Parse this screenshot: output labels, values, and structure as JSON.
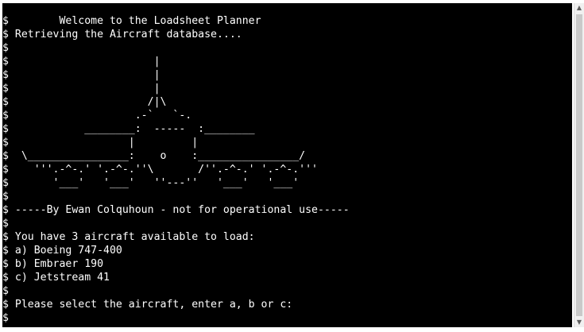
{
  "terminal": {
    "prompt_symbol": "$",
    "lines": [
      "        Welcome to the Loadsheet Planner",
      " Retrieving the Aircraft database....",
      "",
      "                       |",
      "                       |",
      "                       |",
      "                      /|\\",
      "                    .-`   `-.",
      "            ________:  -----  :________",
      "                   |         |",
      "  \\________________:    o    :________________/",
      "    '''.-^-.' '.-^-.''\\       /''.-^-.' '.-^-.'''",
      "       '___'   '___'   ''---''   '___'   '___'",
      "",
      " -----By Ewan Colquhoun - not for operational use-----",
      "",
      " You have 3 aircraft available to load:",
      " a) Boeing 747-400",
      " b) Embraer 190",
      " c) Jetstream 41",
      "",
      " Please select the aircraft, enter a, b or c:",
      ""
    ]
  },
  "scrollbar": {
    "up_arrow_icon": "triangle-up-icon",
    "down_arrow_icon": "triangle-down-icon"
  }
}
